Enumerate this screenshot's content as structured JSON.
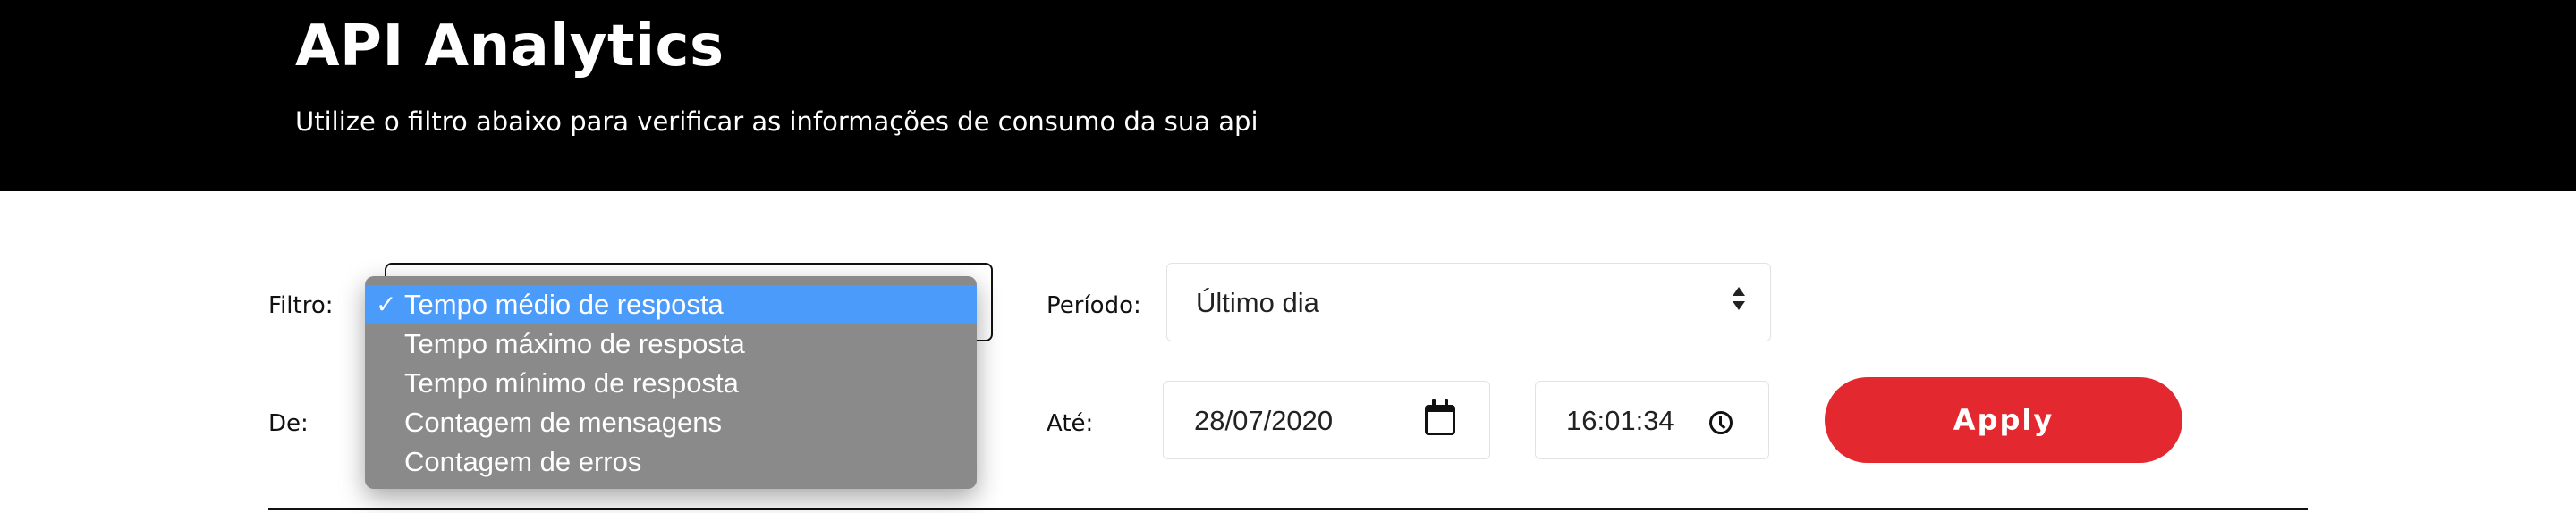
{
  "header": {
    "title": "API Analytics",
    "subtitle": "Utilize o filtro abaixo para verificar as informações de consumo da sua api"
  },
  "filters": {
    "filtro_label": "Filtro:",
    "filtro_options": [
      "Tempo médio de resposta",
      "Tempo máximo de resposta",
      "Tempo mínimo de resposta",
      "Contagem de mensagens",
      "Contagem de erros"
    ],
    "filtro_selected_check": "✓",
    "periodo_label": "Período:",
    "periodo_value": "Último dia",
    "de_label": "De:",
    "ate_label": "Até:",
    "ate_date": "28/07/2020",
    "ate_time": "16:01:34",
    "apply_label": "Apply"
  },
  "icons": {
    "select_arrows": "chevron-up-down-icon",
    "date": "calendar-icon",
    "time": "clock-icon",
    "check": "checkmark-icon"
  },
  "colors": {
    "header_bg": "#000000",
    "apply_button": "#e3282f",
    "dropdown_bg": "#8a8a8a",
    "dropdown_highlight": "#4a9bfa"
  }
}
